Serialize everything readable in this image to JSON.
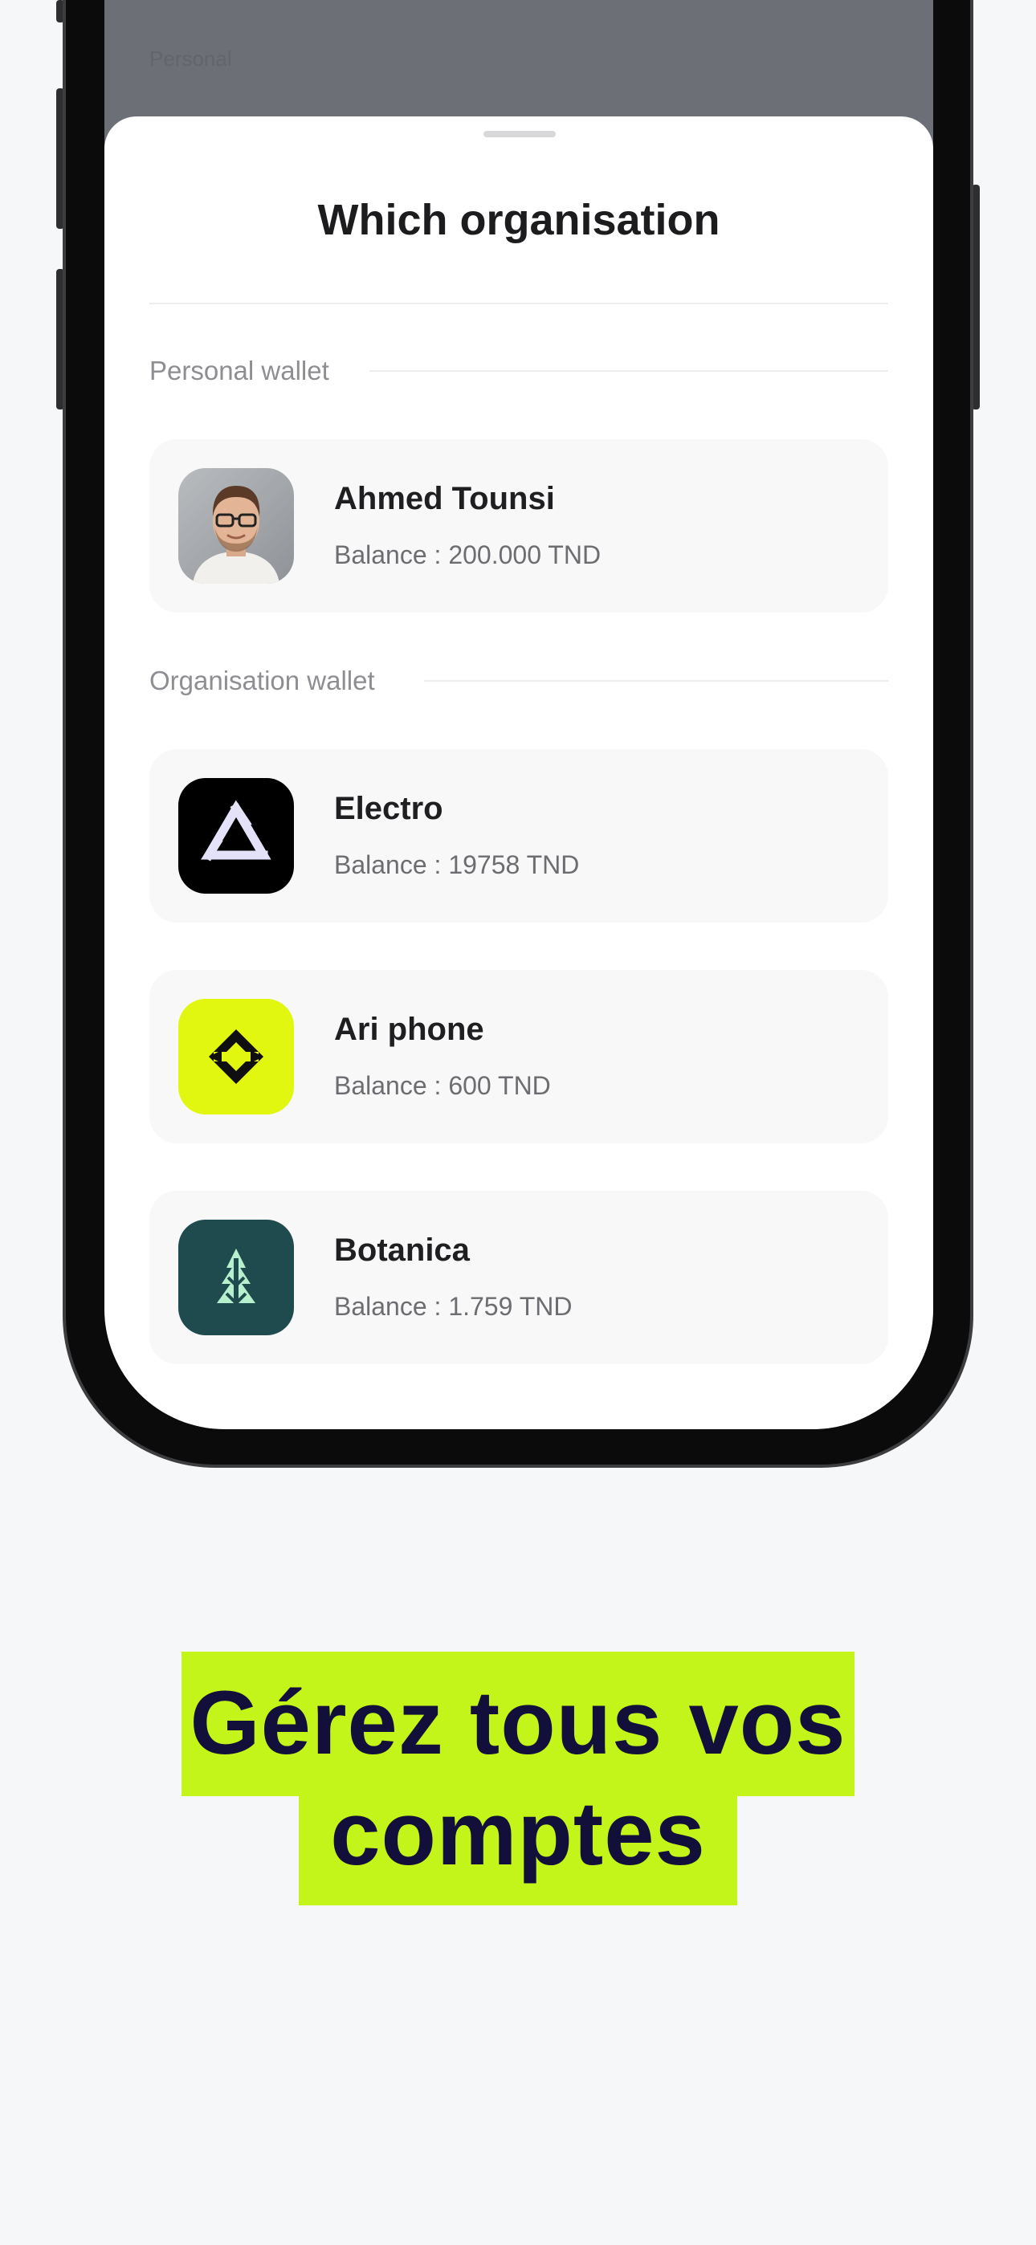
{
  "background": {
    "hint_text": "Personal"
  },
  "sheet": {
    "title": "Which organisation",
    "personal_section_label": "Personal wallet",
    "organisation_section_label": "Organisation wallet"
  },
  "personal_wallet": {
    "name": "Ahmed Tounsi",
    "balance": "Balance : 200.000 TND",
    "icon": "user-avatar"
  },
  "organisation_wallets": [
    {
      "name": "Electro",
      "balance": "Balance : 19758 TND",
      "icon": "electro-logo-icon",
      "color": "#000000"
    },
    {
      "name": "Ari phone",
      "balance": "Balance : 600 TND",
      "icon": "ari-phone-logo-icon",
      "color": "#e1f70f"
    },
    {
      "name": "Botanica",
      "balance": "Balance : 1.759 TND",
      "icon": "botanica-logo-icon",
      "color": "#1f4a4e"
    }
  ],
  "headline": {
    "line1": "Gérez tous vos",
    "line2": "comptes",
    "highlight_color": "#c4f51a",
    "text_color": "#12103a"
  }
}
